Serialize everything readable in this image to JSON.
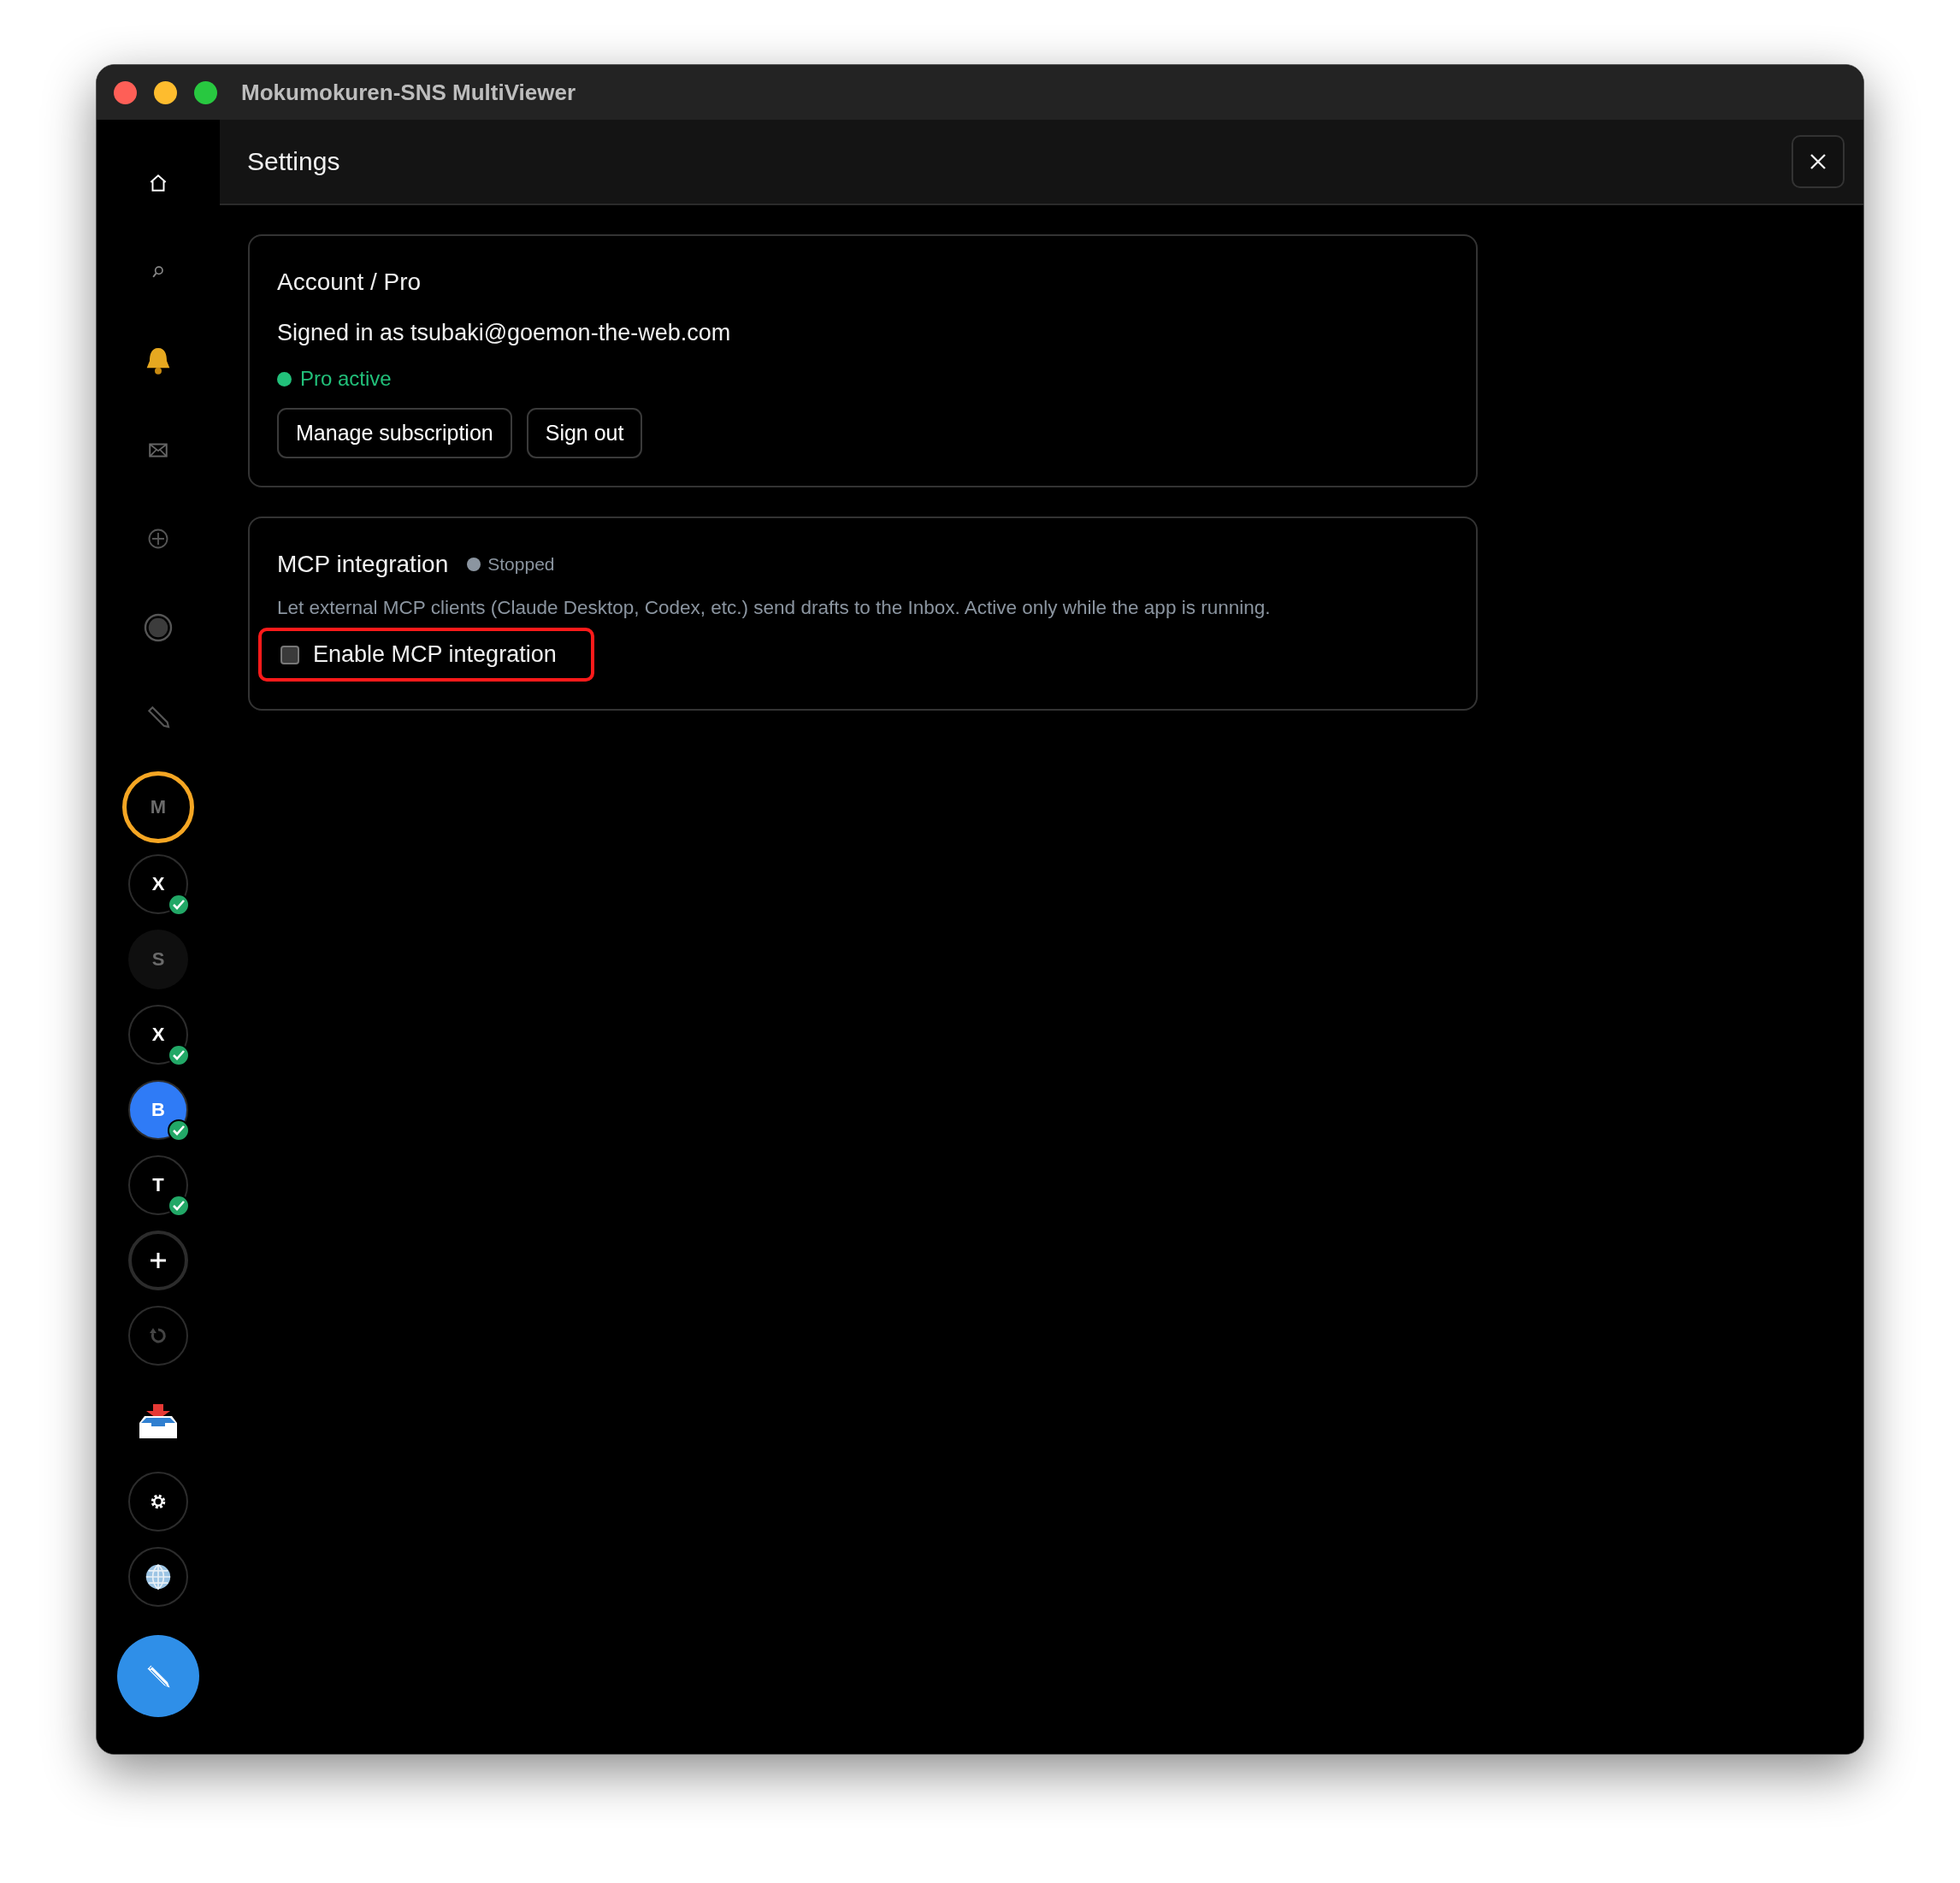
{
  "window": {
    "title": "Mokumokuren-SNS MultiViewer"
  },
  "sidebar": {
    "accounts": [
      {
        "letter": "M",
        "selected": true,
        "verified": false,
        "disabled": true,
        "color": "#000000"
      },
      {
        "letter": "X",
        "selected": false,
        "verified": true,
        "disabled": false,
        "color": "#000000"
      },
      {
        "letter": "S",
        "selected": false,
        "verified": false,
        "disabled": true,
        "color": "#0f0f0f"
      },
      {
        "letter": "X",
        "selected": false,
        "verified": true,
        "disabled": false,
        "color": "#000000"
      },
      {
        "letter": "B",
        "selected": false,
        "verified": true,
        "disabled": false,
        "color": "#2f7bf6"
      },
      {
        "letter": "T",
        "selected": false,
        "verified": true,
        "disabled": false,
        "color": "#000000"
      }
    ]
  },
  "header": {
    "title": "Settings"
  },
  "account_card": {
    "title": "Account / Pro",
    "signed_in": "Signed in as tsubaki@goemon-the-web.com",
    "status": "Pro active",
    "status_active": true,
    "buttons": [
      "Manage subscription",
      "Sign out"
    ]
  },
  "mcp_card": {
    "title": "MCP integration",
    "status": "Stopped",
    "status_active": false,
    "description": "Let external MCP clients (Claude Desktop, Codex, etc.) send drafts to the Inbox. Active only while the app is running.",
    "option": {
      "label": "Enable MCP integration",
      "checked": false,
      "highlighted": true
    }
  }
}
